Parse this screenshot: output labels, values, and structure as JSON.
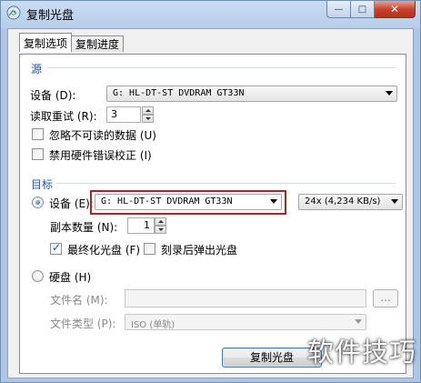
{
  "window": {
    "title": "复制光盘",
    "buttons": {
      "minimize": "—",
      "maximize": "□",
      "close": "✕"
    },
    "close_color": "#c7442f"
  },
  "tabs": [
    {
      "label": "复制选项",
      "active": true
    },
    {
      "label": "复制进度",
      "active": false
    }
  ],
  "source": {
    "group_label": "源",
    "device_label": "设备 (D):",
    "device_value": "G: HL-DT-ST DVDRAM GT33N",
    "retries_label": "读取重试 (R):",
    "retries_value": "3",
    "ignore_unreadable_label": "忽略不可读的数据 (U)",
    "ignore_unreadable_checked": false,
    "disable_hw_correction_label": "禁用硬件错误校正 (I)",
    "disable_hw_correction_checked": false
  },
  "target": {
    "group_label": "目标",
    "device_radio_label": "设备 (E):",
    "device_radio_selected": true,
    "device_value": "G: HL-DT-ST DVDRAM GT33N",
    "speed_value": "24x (4,234 KB/s)",
    "copies_label": "副本数量 (N):",
    "copies_value": "1",
    "finalize_label": "最终化光盘 (F)",
    "finalize_checked": true,
    "eject_label": "刻录后弹出光盘",
    "eject_checked": false,
    "highlight_color": "#b22222"
  },
  "harddisk": {
    "radio_label": "硬盘 (H)",
    "radio_selected": false,
    "filename_label": "文件名 (M):",
    "filename_value": "",
    "browse_label": "...",
    "filetype_label": "文件类型 (P):",
    "filetype_value": "ISO (单轨)"
  },
  "footer": {
    "copy_button_label": "复制光盘"
  },
  "watermark": "软件技巧",
  "colors": {
    "group_label": "#1e55b0",
    "title_bar": "#b7cde9"
  }
}
